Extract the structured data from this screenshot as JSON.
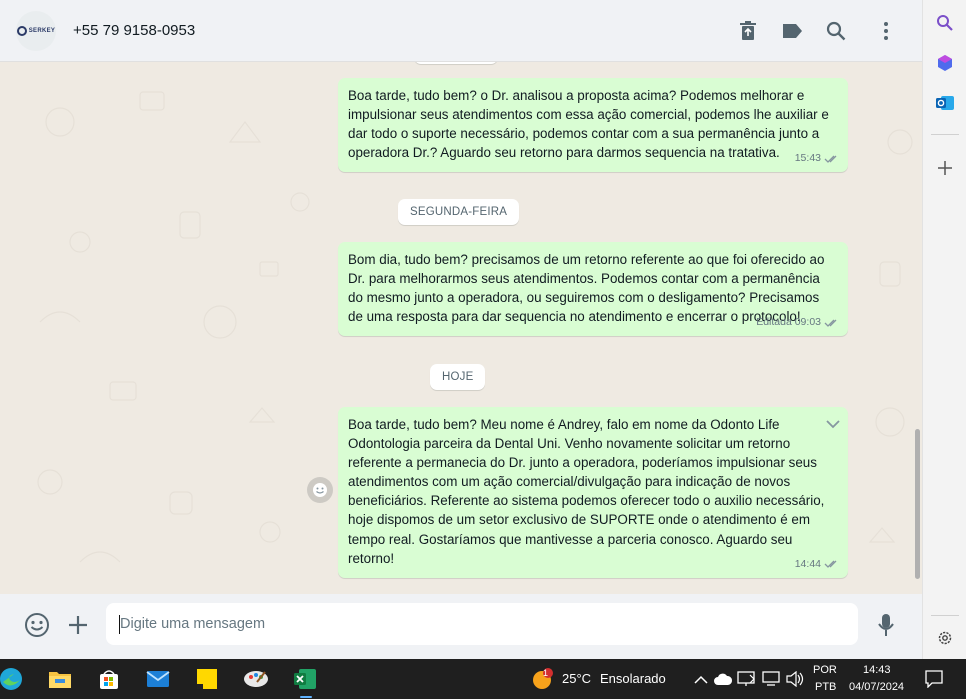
{
  "header": {
    "avatar_logo": "SERKEY",
    "contact_name": "+55 79 9158-0953"
  },
  "messages": [
    {
      "text": "Boa tarde, tudo bem? o Dr. analisou a proposta acima? Podemos melhorar e impulsionar seus atendimentos com essa ação comercial, podemos lhe auxiliar e dar todo o suporte necessário, podemos contar com a sua permanência junto a operadora Dr.? Aguardo seu retorno para darmos sequencia na tratativa.",
      "time": "15:43"
    },
    {
      "text": "Bom dia, tudo bem? precisamos de um retorno referente ao que foi oferecido ao Dr. para melhorarmos seus atendimentos. Podemos contar com a permanência do mesmo junto a operadora, ou seguiremos com o desligamento? Precisamos de uma resposta para dar sequencia no atendimento e encerrar o protocolo!",
      "time": "Editada 09:03"
    },
    {
      "text": "Boa tarde, tudo bem? Meu nome é Andrey, falo em nome da Odonto Life Odontologia parceira da Dental Uni. Venho novamente solicitar um retorno referente a permanecia do Dr. junto a operadora, poderíamos impulsionar seus atendimentos com um ação comercial/divulgação para indicação de novos beneficiários. Referente ao sistema podemos oferecer todo o auxilio necessário, hoje dispomos de um setor exclusivo de SUPORTE onde o atendimento é em tempo real. Gostaríamos que mantivesse a parceria conosco. Aguardo seu retorno!",
      "time": "14:44"
    }
  ],
  "day_chips": [
    "SEGUNDA-FEIRA",
    "HOJE"
  ],
  "composer": {
    "placeholder": "Digite uma mensagem"
  },
  "taskbar": {
    "weather_badge": "1",
    "weather_temp": "25°C",
    "weather_text": "Ensolarado",
    "lang_top": "POR",
    "lang_bottom": "PTB",
    "clock_time": "14:43",
    "clock_date": "04/07/2024"
  },
  "colors": {
    "bubble_out": "#d9fdd3",
    "chat_bg": "#efeae2",
    "panel": "#f0f2f5",
    "tick": "#8696a0"
  },
  "icons": [
    "delete-icon",
    "label-icon",
    "search-icon",
    "menu-icon",
    "emoji-icon",
    "attach-icon",
    "mic-icon",
    "chevron-down-icon"
  ]
}
